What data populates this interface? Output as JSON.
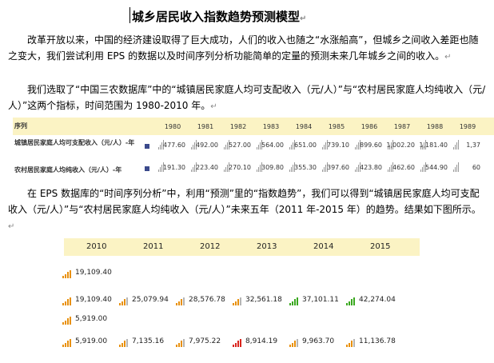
{
  "document": {
    "title": "城乡居民收入指数趋势预测模型",
    "paragraph_mark": "↵",
    "paragraph1": "改革开放以来，中国的经济建设取得了巨大成功，人们的收入也随之“水涨船高”，但城乡之间收入差距也随之变大，我们尝试利用 EPS 的数据以及时间序列分析功能简单的定量的预测未来几年城乡之间的收入。",
    "paragraph2": "我们选取了“中国三农数据库”中的“城镇居民家庭人均可支配收入（元/人）”与“农村居民家庭人均纯收入（元/人）”这两个指标，时间范围为 1980-2010 年。",
    "paragraph3": "在 EPS 数据库的“时间序列分析”中，利用“预测”里的“指数趋势”，我们可以得到“城镇居民家庭人均可支配收入（元/人）”与“农村居民家庭人均纯收入（元/人）”未来五年（2011 年-2015 年）的趋势。结果如下图所示。"
  },
  "table1": {
    "header_label": "序列",
    "years": [
      "1980",
      "1981",
      "1982",
      "1983",
      "1984",
      "1985",
      "1986",
      "1987",
      "1988",
      "1989"
    ],
    "rows": [
      {
        "label": "城镇居民家庭人均可支配收入（元/人）-年",
        "values": [
          "477.60",
          "492.00",
          "527.00",
          "564.00",
          "651.00",
          "739.10",
          "899.60",
          "1,002.20",
          "1,181.40",
          "1,37"
        ]
      },
      {
        "label": "农村居民家庭人均纯收入（元/人）-年",
        "values": [
          "191.30",
          "223.40",
          "270.10",
          "309.80",
          "355.30",
          "397.60",
          "423.80",
          "462.60",
          "544.90",
          "60"
        ]
      }
    ],
    "colors": {
      "header_bg": "#fbf3c4",
      "legend": "#3b4a8c",
      "bar": "#9a9a9a"
    }
  },
  "table2": {
    "years": [
      "2010",
      "2011",
      "2012",
      "2013",
      "2014",
      "2015"
    ],
    "rows": [
      {
        "values": [
          "19,109.40"
        ]
      },
      {
        "values": [
          "19,109.40",
          "25,079.94",
          "28,576.78",
          "32,561.18",
          "37,101.11",
          "42,274.04"
        ]
      },
      {
        "values": [
          "5,919.00"
        ]
      },
      {
        "values": [
          "5,919.00",
          "7,135.16",
          "7,975.22",
          "8,914.19",
          "9,963.70",
          "11,136.78"
        ]
      }
    ],
    "bar_colors": {
      "orange": "#e8900c",
      "green": "#3aa81f",
      "red": "#d9241c",
      "grey": "#b5b5b5"
    }
  }
}
